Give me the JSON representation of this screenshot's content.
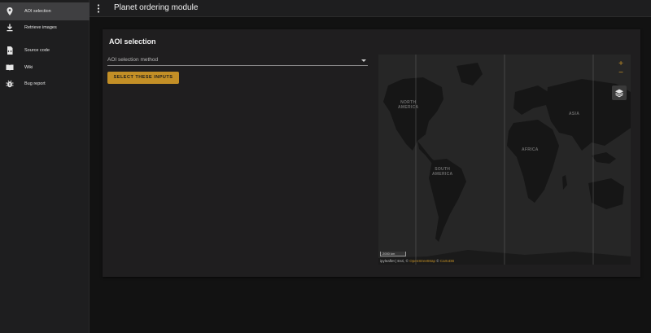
{
  "sidebar": {
    "items": [
      {
        "label": "AOI selection",
        "icon": "map-marker-icon",
        "active": true
      },
      {
        "label": "Retrieve images",
        "icon": "download-icon",
        "active": false
      },
      {
        "label": "Source code",
        "icon": "file-code-icon",
        "active": false
      },
      {
        "label": "Wiki",
        "icon": "book-icon",
        "active": false
      },
      {
        "label": "Bug report",
        "icon": "bug-icon",
        "active": false
      }
    ]
  },
  "appbar": {
    "title": "Planet ordering module",
    "menu_icon": "vertical-dots-icon"
  },
  "main": {
    "card_title": "AOI selection",
    "select_label": "AOI selection method",
    "submit_label": "SELECT THESE INPUTS"
  },
  "map": {
    "zoom_in": "+",
    "zoom_out": "−",
    "labels": {
      "north_america": "NORTH\nAMERICA",
      "south_america": "SOUTH\nAMERICA",
      "africa": "AFRICA",
      "asia": "ASIA"
    },
    "scale": "2000 km",
    "attribution_prefix": "ipyleaflet | Esri, © ",
    "attribution_osm": "OpenStreetMap",
    "attribution_sep": " © ",
    "attribution_carto": "CartoDB"
  },
  "colors": {
    "accent": "#c38f26",
    "background": "#121212",
    "surface": "#1f1e1f"
  }
}
